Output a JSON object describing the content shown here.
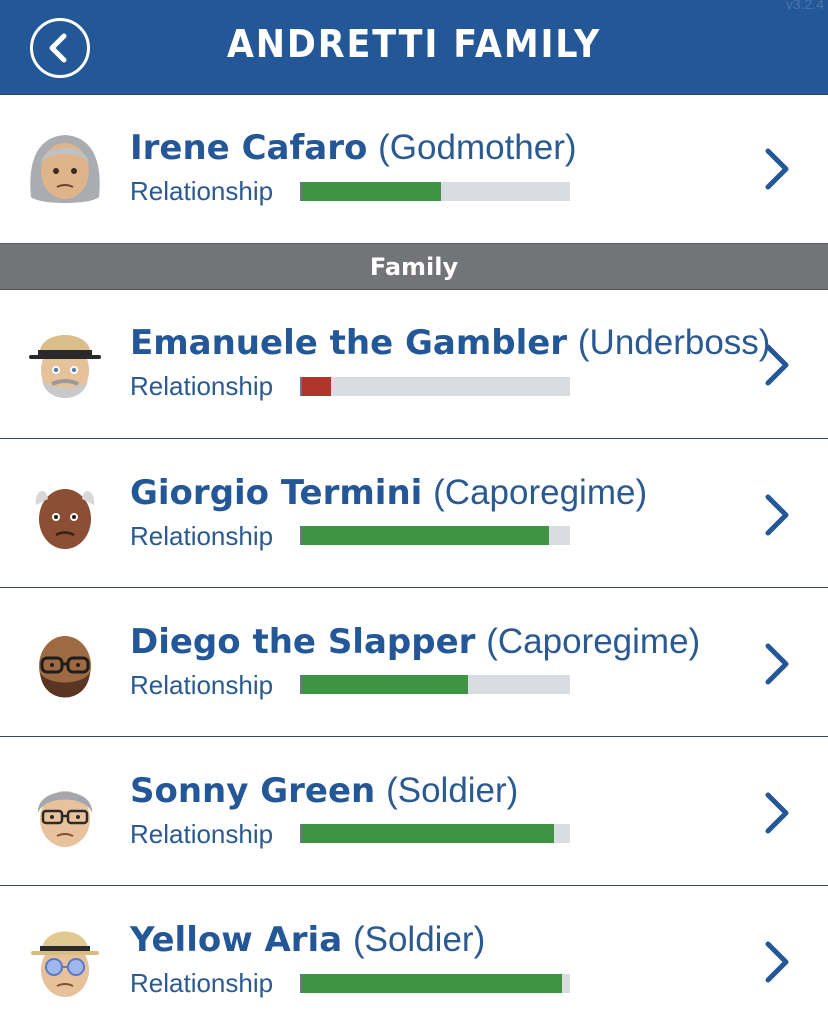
{
  "header": {
    "title": "ANDRETTI FAMILY",
    "version": "v3.2.4",
    "back_icon": "chevron-left-circle-icon",
    "background_color": "#245797"
  },
  "leader": {
    "name": "Irene Cafaro",
    "role": "(Godmother)",
    "relationship_label": "Relationship",
    "relationship": 0.52,
    "bar_color": "#3f9444"
  },
  "section": {
    "title": "Family"
  },
  "members": [
    {
      "name": "Emanuele the Gambler",
      "role": "(Underboss)",
      "relationship_label": "Relationship",
      "relationship": 0.11,
      "bar_color": "#b0352a"
    },
    {
      "name": "Giorgio Termini",
      "role": "(Caporegime)",
      "relationship_label": "Relationship",
      "relationship": 0.92,
      "bar_color": "#3f9444"
    },
    {
      "name": "Diego the Slapper",
      "role": "(Caporegime)",
      "relationship_label": "Relationship",
      "relationship": 0.62,
      "bar_color": "#3f9444"
    },
    {
      "name": "Sonny Green",
      "role": "(Soldier)",
      "relationship_label": "Relationship",
      "relationship": 0.94,
      "bar_color": "#3f9444"
    },
    {
      "name": "Yellow Aria",
      "role": "(Soldier)",
      "relationship_label": "Relationship",
      "relationship": 0.97,
      "bar_color": "#3f9444"
    }
  ],
  "colors": {
    "good": "#3f9444",
    "bad": "#b0352a",
    "track": "#d9dde2",
    "text": "#245797"
  }
}
